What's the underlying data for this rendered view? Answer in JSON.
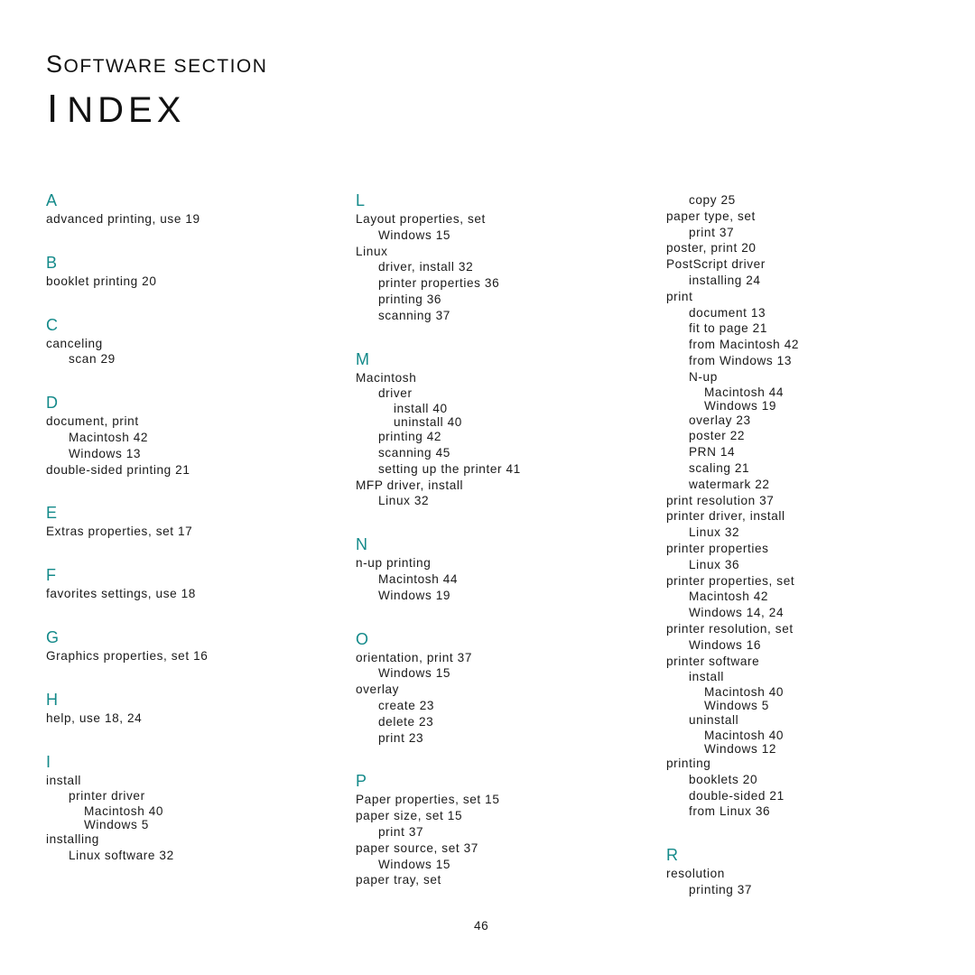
{
  "header": {
    "section_first": "S",
    "section_rest": "OFTWARE SECTION",
    "title_first": "I",
    "title_rest": "NDEX"
  },
  "accent_color": "#148a8a",
  "columns": [
    [
      {
        "letter": "A",
        "lines": [
          {
            "t": "advanced printing, use 19",
            "l": 1
          }
        ]
      },
      {
        "letter": "B",
        "lines": [
          {
            "t": "booklet printing 20",
            "l": 1
          }
        ]
      },
      {
        "letter": "C",
        "lines": [
          {
            "t": "canceling",
            "l": 1
          },
          {
            "t": "scan 29",
            "l": 2
          }
        ]
      },
      {
        "letter": "D",
        "lines": [
          {
            "t": "document, print",
            "l": 1
          },
          {
            "t": "Macintosh 42",
            "l": 2
          },
          {
            "t": "Windows 13",
            "l": 2
          },
          {
            "t": "double-sided printing 21",
            "l": 1
          }
        ]
      },
      {
        "letter": "E",
        "lines": [
          {
            "t": "Extras properties, set 17",
            "l": 1
          }
        ]
      },
      {
        "letter": "F",
        "lines": [
          {
            "t": "favorites settings, use 18",
            "l": 1
          }
        ]
      },
      {
        "letter": "G",
        "lines": [
          {
            "t": "Graphics properties, set 16",
            "l": 1
          }
        ]
      },
      {
        "letter": "H",
        "lines": [
          {
            "t": "help, use 18, 24",
            "l": 1
          }
        ]
      },
      {
        "letter": "I",
        "lines": [
          {
            "t": "install",
            "l": 1
          },
          {
            "t": "printer driver",
            "l": 2
          },
          {
            "t": "Macintosh 40",
            "l": 3
          },
          {
            "t": "Windows 5",
            "l": 3
          },
          {
            "t": "installing",
            "l": 1
          },
          {
            "t": "Linux software 32",
            "l": 2
          }
        ]
      }
    ],
    [
      {
        "letter": "L",
        "lines": [
          {
            "t": "Layout properties, set",
            "l": 1
          },
          {
            "t": "Windows 15",
            "l": 2
          },
          {
            "t": "Linux",
            "l": 1
          },
          {
            "t": "driver, install 32",
            "l": 2
          },
          {
            "t": "printer properties 36",
            "l": 2
          },
          {
            "t": "printing 36",
            "l": 2
          },
          {
            "t": "scanning 37",
            "l": 2
          }
        ]
      },
      {
        "letter": "M",
        "lines": [
          {
            "t": "Macintosh",
            "l": 1
          },
          {
            "t": "driver",
            "l": 2
          },
          {
            "t": "install 40",
            "l": 3
          },
          {
            "t": "uninstall 40",
            "l": 3
          },
          {
            "t": "printing 42",
            "l": 2
          },
          {
            "t": "scanning 45",
            "l": 2
          },
          {
            "t": "setting up the printer 41",
            "l": 2
          },
          {
            "t": "MFP driver, install",
            "l": 1
          },
          {
            "t": "Linux 32",
            "l": 2
          }
        ]
      },
      {
        "letter": "N",
        "lines": [
          {
            "t": "n-up printing",
            "l": 1
          },
          {
            "t": "Macintosh 44",
            "l": 2
          },
          {
            "t": "Windows 19",
            "l": 2
          }
        ]
      },
      {
        "letter": "O",
        "lines": [
          {
            "t": "orientation, print 37",
            "l": 1
          },
          {
            "t": "Windows 15",
            "l": 2
          },
          {
            "t": "overlay",
            "l": 1
          },
          {
            "t": "create 23",
            "l": 2
          },
          {
            "t": "delete 23",
            "l": 2
          },
          {
            "t": "print 23",
            "l": 2
          }
        ]
      },
      {
        "letter": "P",
        "lines": [
          {
            "t": "Paper properties, set 15",
            "l": 1
          },
          {
            "t": "paper size, set 15",
            "l": 1
          },
          {
            "t": "print 37",
            "l": 2
          },
          {
            "t": "paper source, set 37",
            "l": 1
          },
          {
            "t": "Windows 15",
            "l": 2
          },
          {
            "t": "paper tray, set",
            "l": 1
          }
        ]
      }
    ],
    [
      {
        "letter": "",
        "lines": [
          {
            "t": "copy 25",
            "l": 2
          },
          {
            "t": "paper type, set",
            "l": 1
          },
          {
            "t": "print 37",
            "l": 2
          },
          {
            "t": "poster, print 20",
            "l": 1
          },
          {
            "t": "PostScript driver",
            "l": 1
          },
          {
            "t": "installing 24",
            "l": 2
          },
          {
            "t": "print",
            "l": 1
          },
          {
            "t": "document 13",
            "l": 2
          },
          {
            "t": "fit to page 21",
            "l": 2
          },
          {
            "t": "from Macintosh 42",
            "l": 2
          },
          {
            "t": "from Windows 13",
            "l": 2
          },
          {
            "t": "N-up",
            "l": 2
          },
          {
            "t": "Macintosh 44",
            "l": 3
          },
          {
            "t": "Windows 19",
            "l": 3
          },
          {
            "t": "overlay 23",
            "l": 2
          },
          {
            "t": "poster 22",
            "l": 2
          },
          {
            "t": "PRN 14",
            "l": 2
          },
          {
            "t": "scaling 21",
            "l": 2
          },
          {
            "t": "watermark 22",
            "l": 2
          },
          {
            "t": "print resolution 37",
            "l": 1
          },
          {
            "t": "printer driver, install",
            "l": 1
          },
          {
            "t": "Linux 32",
            "l": 2
          },
          {
            "t": "printer properties",
            "l": 1
          },
          {
            "t": "Linux 36",
            "l": 2
          },
          {
            "t": "printer properties, set",
            "l": 1
          },
          {
            "t": "Macintosh 42",
            "l": 2
          },
          {
            "t": "Windows 14, 24",
            "l": 2
          },
          {
            "t": "printer resolution, set",
            "l": 1
          },
          {
            "t": "Windows 16",
            "l": 2
          },
          {
            "t": "printer software",
            "l": 1
          },
          {
            "t": "install",
            "l": 2
          },
          {
            "t": "Macintosh 40",
            "l": 3
          },
          {
            "t": "Windows 5",
            "l": 3
          },
          {
            "t": "uninstall",
            "l": 2
          },
          {
            "t": "Macintosh 40",
            "l": 3
          },
          {
            "t": "Windows 12",
            "l": 3
          },
          {
            "t": "printing",
            "l": 1
          },
          {
            "t": "booklets 20",
            "l": 2
          },
          {
            "t": "double-sided 21",
            "l": 2
          },
          {
            "t": "from Linux 36",
            "l": 2
          }
        ]
      },
      {
        "letter": "R",
        "lines": [
          {
            "t": "resolution",
            "l": 1
          },
          {
            "t": "printing 37",
            "l": 2
          }
        ]
      }
    ]
  ],
  "page_number": "46"
}
